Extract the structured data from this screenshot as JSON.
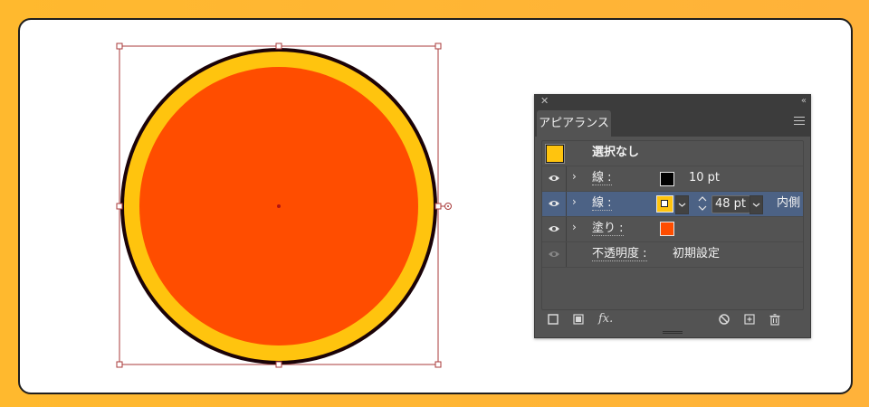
{
  "colors": {
    "background": "#ffb92e",
    "fill": "#ff4d00",
    "stroke_outer": "#ffc40e",
    "stroke_inner": "#1b0308",
    "selection": "#a83a3a"
  },
  "panel": {
    "title": "アピアランス",
    "header": {
      "label": "選択なし"
    },
    "rows": [
      {
        "type": "stroke",
        "label": "線 :",
        "value": "10 pt"
      },
      {
        "type": "stroke",
        "label": "線 :",
        "value": "48 pt",
        "align": "内側"
      },
      {
        "type": "fill",
        "label": "塗り :"
      },
      {
        "type": "opacity",
        "label": "不透明度 :",
        "value": "初期設定"
      }
    ],
    "footer_fx": "fx."
  }
}
